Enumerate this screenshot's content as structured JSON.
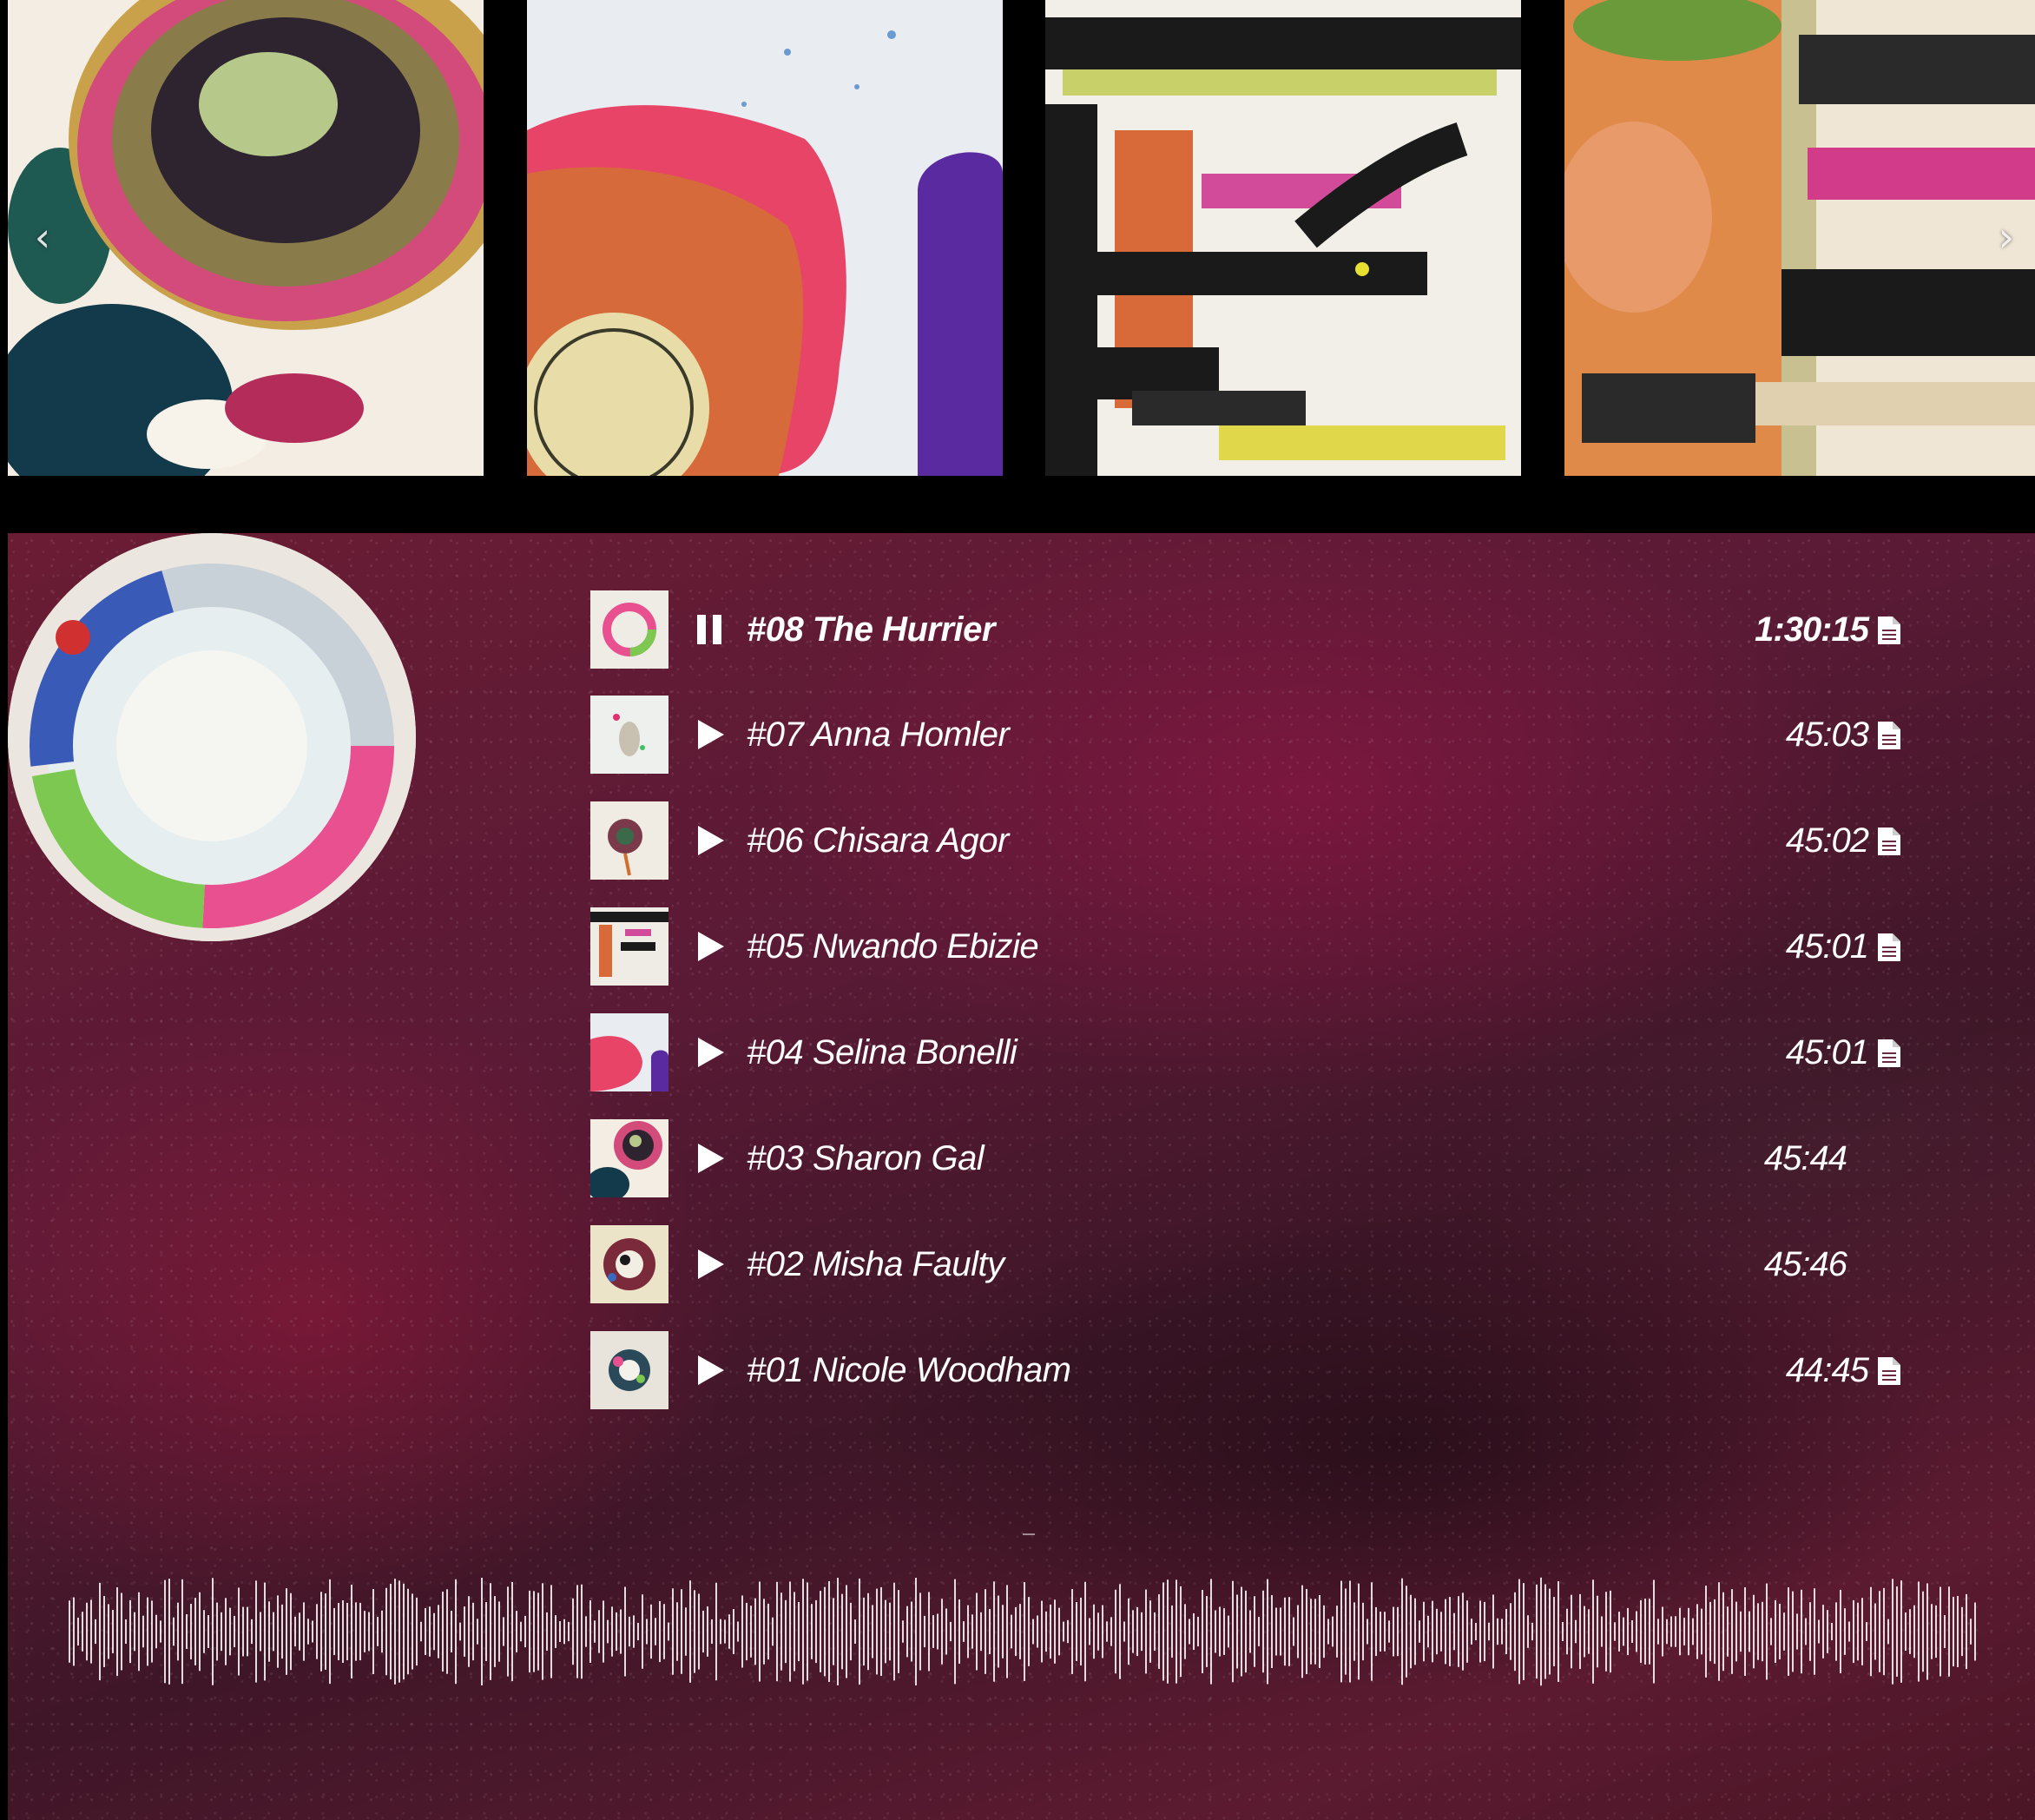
{
  "carousel": {
    "prev_label": "‹",
    "next_label": "›",
    "slides": [
      "slide-1",
      "slide-2",
      "slide-3",
      "slide-4"
    ]
  },
  "player": {
    "tracks": [
      {
        "title": "#08 The Hurrier",
        "duration": "1:30:15",
        "state": "playing",
        "has_transcript": true
      },
      {
        "title": "#07 Anna Homler",
        "duration": "45:03",
        "state": "paused",
        "has_transcript": true
      },
      {
        "title": "#06 Chisara Agor",
        "duration": "45:02",
        "state": "paused",
        "has_transcript": true
      },
      {
        "title": "#05 Nwando Ebizie",
        "duration": "45:01",
        "state": "paused",
        "has_transcript": true
      },
      {
        "title": "#04 Selina Bonelli",
        "duration": "45:01",
        "state": "paused",
        "has_transcript": true
      },
      {
        "title": "#03 Sharon Gal",
        "duration": "45:44",
        "state": "paused",
        "has_transcript": false
      },
      {
        "title": "#02 Misha Faulty",
        "duration": "45:46",
        "state": "paused",
        "has_transcript": false
      },
      {
        "title": "#01 Nicole Woodham",
        "duration": "44:45",
        "state": "paused",
        "has_transcript": true
      }
    ],
    "colors": {
      "text": "#ffffff",
      "background": "#5a1a35"
    },
    "icons": {
      "play": "play-icon",
      "pause": "pause-icon",
      "transcript": "document-icon"
    }
  }
}
